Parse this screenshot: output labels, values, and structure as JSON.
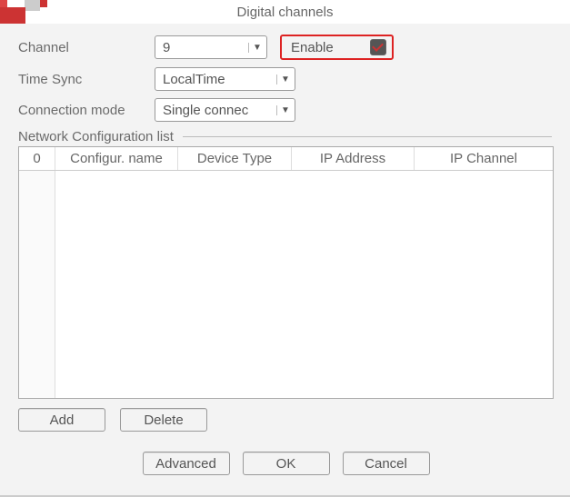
{
  "window": {
    "title": "Digital channels"
  },
  "form": {
    "channel_label": "Channel",
    "channel_value": "9",
    "enable_label": "Enable",
    "enable_checked": true,
    "timesync_label": "Time Sync",
    "timesync_value": "LocalTime",
    "connmode_label": "Connection mode",
    "connmode_value": "Single connec"
  },
  "list": {
    "title": "Network Configuration list",
    "columns": [
      "0",
      "Configur. name",
      "Device Type",
      "IP Address",
      "IP Channel"
    ],
    "rows": []
  },
  "buttons": {
    "add": "Add",
    "delete": "Delete",
    "advanced": "Advanced",
    "ok": "OK",
    "cancel": "Cancel"
  }
}
